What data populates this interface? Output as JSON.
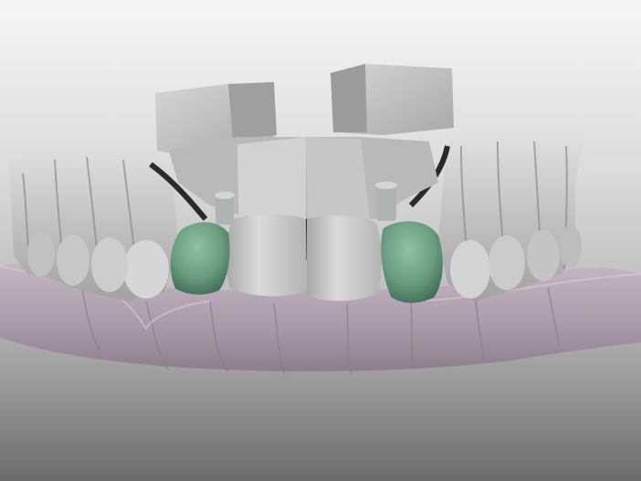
{
  "scene": {
    "description_hidden": "",
    "background_top": "#f6f6f6",
    "background_bottom": "#6b6b6b"
  },
  "colors": {
    "scan_gray": "#c7c7c7",
    "scan_gray_dark": "#8d8d8d",
    "scan_gray_light": "#e3e3e3",
    "gum_lilac": "#b9a9b9",
    "gum_lilac_dark": "#8f7f8f",
    "crown_green": "#6ea386",
    "crown_green_dark": "#3f6b55",
    "abutment_gray": "#aeb3b3",
    "black_gap": "#2a2a2a"
  },
  "objects": {
    "model": "dental-scan-model",
    "left_crown": "implant-crown-left",
    "right_crown": "implant-crown-right"
  }
}
